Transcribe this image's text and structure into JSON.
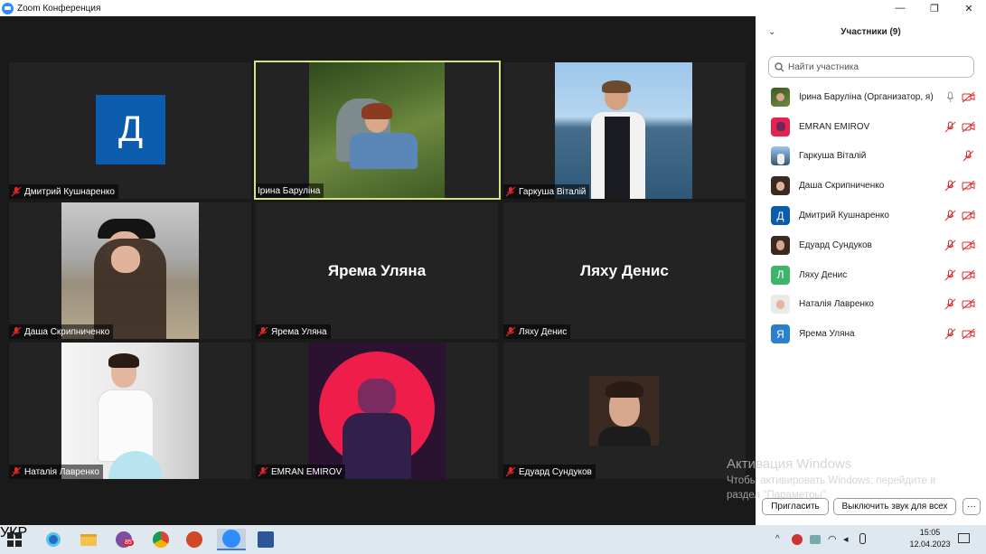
{
  "window": {
    "title": "Zoom Конференция"
  },
  "tiles": [
    {
      "name": "Дмитрий Кушнаренко",
      "avatar_letter": "Д"
    },
    {
      "name": "Ірина Баруліна",
      "active": true
    },
    {
      "name": "Гаркуша Віталій"
    },
    {
      "name": "Даша Скрипниченко"
    },
    {
      "name": "Ярема Уляна",
      "display_name": "Ярема Уляна"
    },
    {
      "name": "Ляху Денис",
      "display_name": "Ляху Денис"
    },
    {
      "name": "Наталія Лавренко"
    },
    {
      "name": "EMRAN EMIROV"
    },
    {
      "name": "Едуард Сундуков"
    }
  ],
  "panel": {
    "title": "Участники (9)",
    "search_placeholder": "Найти участника",
    "participants": [
      {
        "name": "Ірина Баруліна (Организатор, я)",
        "avatar": "photo"
      },
      {
        "name": "EMRAN EMIROV",
        "avatar": "photo"
      },
      {
        "name": "Гаркуша Віталій",
        "avatar": "photo"
      },
      {
        "name": "Даша Скрипниченко",
        "avatar": "photo"
      },
      {
        "name": "Дмитрий Кушнаренко",
        "avatar_letter": "Д",
        "avatar_color": "#0b5cad"
      },
      {
        "name": "Едуард Сундуков",
        "avatar": "photo"
      },
      {
        "name": "Ляху Денис",
        "avatar_letter": "Л",
        "avatar_color": "#3fb36b"
      },
      {
        "name": "Наталія Лавренко",
        "avatar": "photo"
      },
      {
        "name": "Ярема Уляна",
        "avatar_letter": "Я",
        "avatar_color": "#2a80d0"
      }
    ],
    "invite_label": "Пригласить",
    "mute_all_label": "Выключить звук для всех",
    "more_label": "···"
  },
  "watermark": {
    "line1": "Активация Windows",
    "line2": "Чтобы активировать Windows, перейдите в",
    "line3": "раздел \"Параметры\"."
  },
  "taskbar": {
    "viber_badge": "85",
    "lang": "УКР",
    "time": "15:05",
    "date": "12.04.2023"
  },
  "colors": {
    "active_speaker": "#d7e37c",
    "mute_red": "#e02828",
    "zoom_blue": "#2d8cff"
  }
}
